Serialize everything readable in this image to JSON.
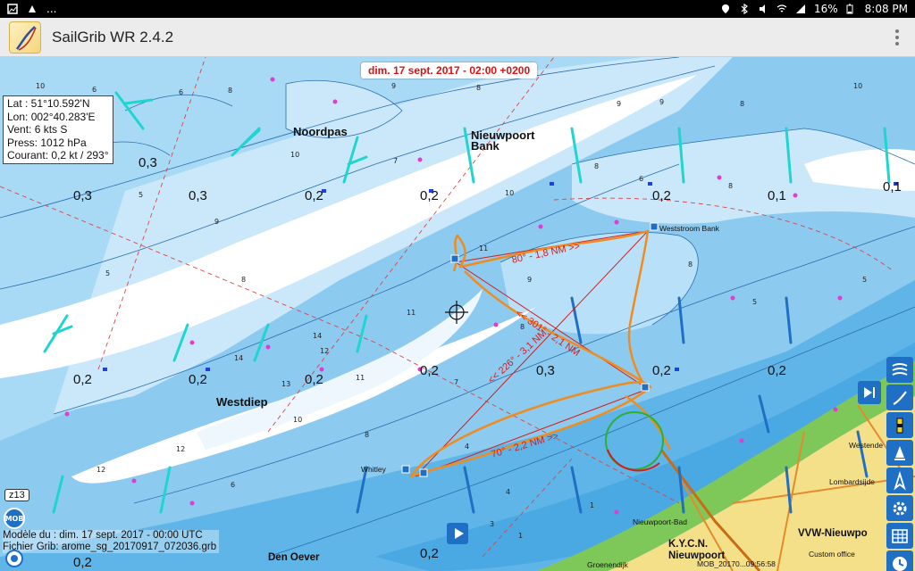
{
  "status_bar": {
    "notifications": "...",
    "battery": "16%",
    "time": "8:08 PM"
  },
  "app": {
    "title": "SailGrib WR 2.4.2"
  },
  "map": {
    "date_banner": "dim. 17 sept. 2017 - 02:00 +0200",
    "info": {
      "lat": "Lat :  51°10.592'N",
      "lon": "Lon: 002°40.283'E",
      "wind": "Vent:    6 kts  S",
      "pressure": "Press: 1012 hPa",
      "current": "Courant: 0,2 kt / 293°"
    },
    "zoom": "z13",
    "mob": "MOB",
    "model_line": "Modèle du : dim. 17 sept. 2017 - 00:00 UTC",
    "file_line": "Fichier Grib: arome_sg_20170917_072036.grb",
    "places": {
      "noordpas": "Noordpas",
      "nieuwpoort_bank": "Nieuwpoort\nBank",
      "westdiep": "Westdiep",
      "weststroom": "Weststroom Bank",
      "den_oever": "Den Oever",
      "whitley": "Whitley",
      "westende": "Westende",
      "lombardsijde": "Lombardsijde",
      "nieuwpoort_bad": "Nieuwpoort-Bad",
      "kycn": "K.Y.C.N.\nNieuwpoort",
      "vvw": "VVW-Nieuwpo",
      "groenendijk": "Groenendijk",
      "custom_office": "Custom office",
      "mob_ts": "MOB_20170...09:56:58"
    },
    "current_values": [
      "0,3",
      "0,3",
      "0,3",
      "0,2",
      "0,2",
      "0,2",
      "0,1",
      "0,1",
      "0,2",
      "0,2",
      "0,2",
      "0,3",
      "0,2",
      "0,2",
      "0,2",
      "0,2",
      "0,2"
    ],
    "course_labels": {
      "leg1": "80° - 1,8 NM >>",
      "leg2": "<< 301° - 2,1 NM",
      "leg3": "<< 226° - 3,1 NM",
      "leg4": "70° - 2,2 NM >>"
    },
    "colors": {
      "deep_water": "#5fb5e8",
      "mid_water": "#9fd3f3",
      "shoal": "#cbe8fa",
      "shallow": "#ffffff",
      "land": "#f5e08a",
      "beach": "#7ec85a",
      "track": "#f08c1e",
      "route": "#d61d1d",
      "wind_cyan": "#1fd5cf",
      "wind_blue": "#1f6fc4",
      "ui_blue": "#1f6fc4"
    }
  }
}
